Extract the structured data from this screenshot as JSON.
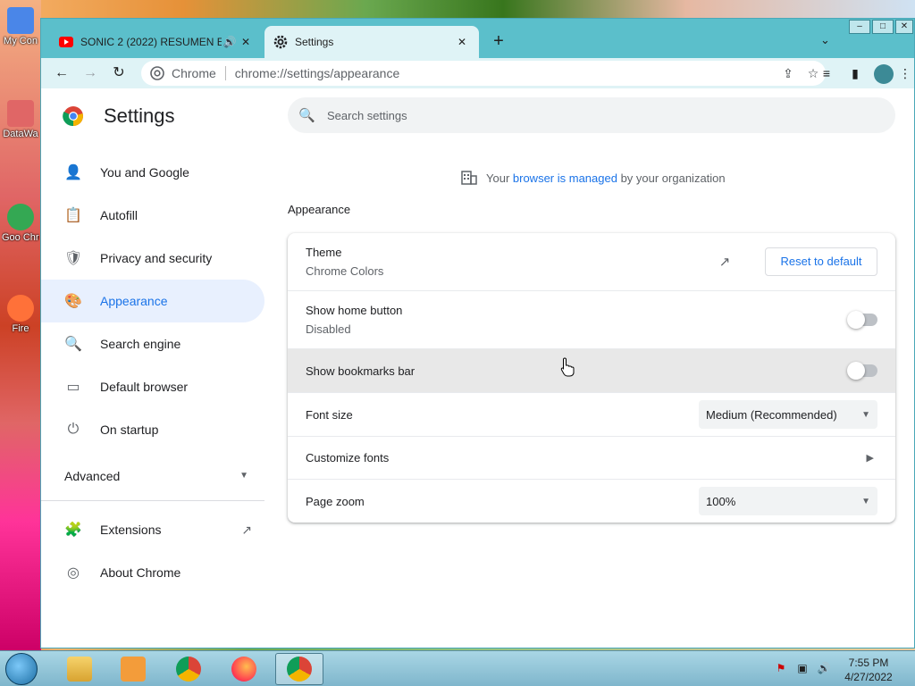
{
  "desktop": {
    "icons": [
      {
        "label": "My Con",
        "color": "#4a86e8"
      },
      {
        "label": "DataWa",
        "color": "#e06666"
      },
      {
        "label": "Goo Chro",
        "color": "#34a853"
      },
      {
        "label": "Fire",
        "color": "#ff7139"
      }
    ]
  },
  "tabs": [
    {
      "title": "SONIC 2 (2022) RESUMEN E",
      "favicon": "youtube-icon",
      "audio": "🔊",
      "close": "✕"
    },
    {
      "title": "Settings",
      "favicon": "gear-icon",
      "close": "✕"
    }
  ],
  "newtab": "+",
  "tabsearch": "⌄",
  "window_controls": {
    "minimize": "–",
    "maximize": "□",
    "close": "✕"
  },
  "toolbar": {
    "back": "←",
    "forward": "→",
    "reload": "↻",
    "omnibox_chrome": "Chrome",
    "url": "chrome://settings/appearance",
    "share": "⇪",
    "star": "☆",
    "reading_list": "≡",
    "side_panel": "▮"
  },
  "settings": {
    "title": "Settings",
    "search_placeholder": "Search settings",
    "managed": {
      "prefix": "Your ",
      "link": "browser is managed",
      "suffix": " by your organization"
    },
    "nav": [
      {
        "label": "You and Google",
        "icon": "person-icon",
        "glyph": "👤"
      },
      {
        "label": "Autofill",
        "icon": "clipboard-icon",
        "glyph": "📋"
      },
      {
        "label": "Privacy and security",
        "icon": "shield-icon",
        "glyph": "🛡"
      },
      {
        "label": "Appearance",
        "icon": "palette-icon",
        "glyph": "🎨"
      },
      {
        "label": "Search engine",
        "icon": "search-icon",
        "glyph": "🔍"
      },
      {
        "label": "Default browser",
        "icon": "browser-icon",
        "glyph": "▭"
      },
      {
        "label": "On startup",
        "icon": "power-icon",
        "glyph": "⏻"
      }
    ],
    "advanced": "Advanced",
    "nav_bottom": [
      {
        "label": "Extensions",
        "icon": "puzzle-icon",
        "glyph": "🧩"
      },
      {
        "label": "About Chrome",
        "icon": "chrome-icon",
        "glyph": "◎"
      }
    ],
    "section": "Appearance",
    "rows": {
      "theme": {
        "label": "Theme",
        "sub": "Chrome Colors",
        "button": "Reset to default"
      },
      "home": {
        "label": "Show home button",
        "sub": "Disabled"
      },
      "bookmarks": {
        "label": "Show bookmarks bar"
      },
      "font_size": {
        "label": "Font size",
        "value": "Medium (Recommended)"
      },
      "fonts": {
        "label": "Customize fonts"
      },
      "zoom": {
        "label": "Page zoom",
        "value": "100%"
      }
    }
  },
  "taskbar": {
    "time": "7:55 PM",
    "date": "4/27/2022"
  },
  "colors": {
    "accent": "#1a73e8",
    "titlebar": "#5bbfcb",
    "toolbar": "#dff3f6"
  }
}
